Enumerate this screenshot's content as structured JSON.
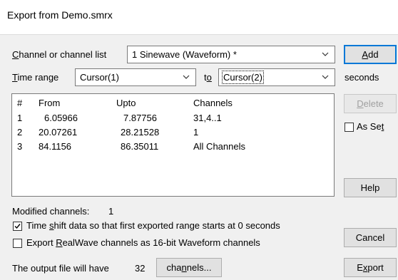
{
  "window": {
    "title": "Export from Demo.smrx"
  },
  "channel": {
    "label": "Channel or channel list",
    "value": "1 Sinewave (Waveform) *"
  },
  "time_range": {
    "label": "Time range",
    "from_value": "Cursor(1)",
    "to_label": "to",
    "to_value": "Cursor(2)",
    "units": "seconds"
  },
  "table": {
    "columns": [
      "#",
      "From",
      "Upto",
      "Channels"
    ],
    "rows": [
      {
        "num": "1",
        "from": "6.05966",
        "upto": "7.87756",
        "channels": "31,4..1"
      },
      {
        "num": "2",
        "from": "20.07261",
        "upto": "28.21528",
        "channels": "1"
      },
      {
        "num": "3",
        "from": "84.1156",
        "upto": "86.35011",
        "channels": "All Channels"
      }
    ]
  },
  "buttons": {
    "add": "Add",
    "delete": "Delete",
    "help": "Help",
    "cancel": "Cancel",
    "export": "Export",
    "channels": "channels..."
  },
  "as_set": {
    "label": "As Set",
    "checked": false
  },
  "modified_channels": {
    "label": "Modified channels:",
    "value": "1"
  },
  "time_shift": {
    "label": "Time shift data so that first exported range starts at 0 seconds",
    "checked": true
  },
  "realwave": {
    "label": "Export RealWave channels as 16-bit Waveform channels",
    "checked": false
  },
  "output": {
    "label": "The output file will have",
    "count": "32"
  }
}
